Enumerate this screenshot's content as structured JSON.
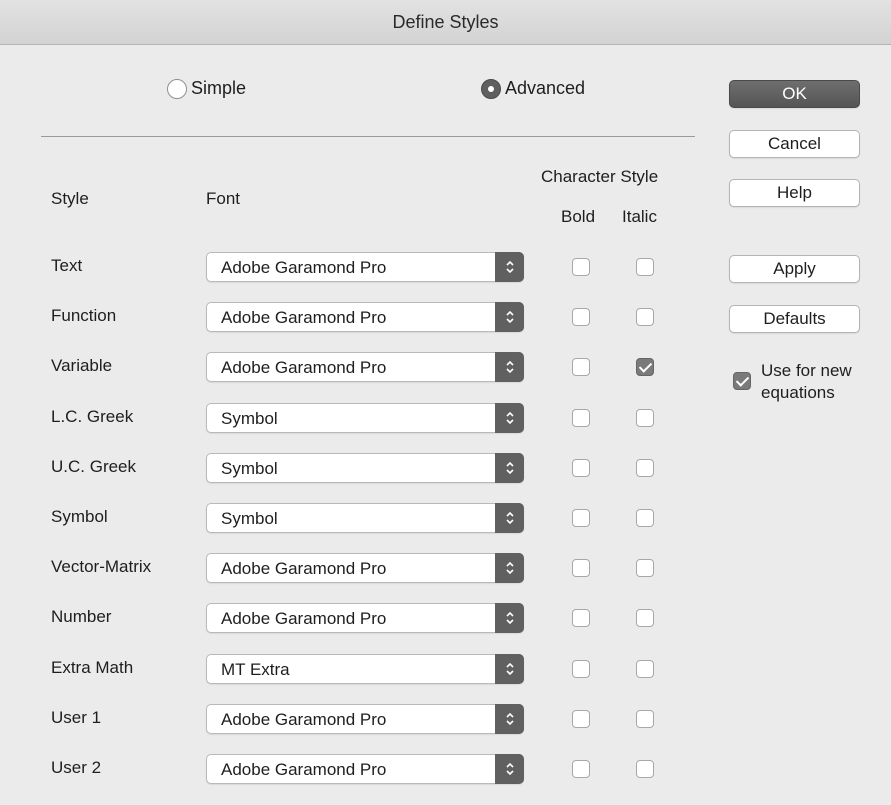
{
  "window": {
    "title": "Define Styles"
  },
  "mode": {
    "simple_label": "Simple",
    "advanced_label": "Advanced",
    "selected": "Advanced"
  },
  "headers": {
    "style": "Style",
    "font": "Font",
    "character_style": "Character Style",
    "bold": "Bold",
    "italic": "Italic"
  },
  "rows": [
    {
      "style": "Text",
      "font": "Adobe Garamond Pro",
      "bold": false,
      "italic": false
    },
    {
      "style": "Function",
      "font": "Adobe Garamond Pro",
      "bold": false,
      "italic": false
    },
    {
      "style": "Variable",
      "font": "Adobe Garamond Pro",
      "bold": false,
      "italic": true
    },
    {
      "style": "L.C. Greek",
      "font": "Symbol",
      "bold": false,
      "italic": false
    },
    {
      "style": "U.C. Greek",
      "font": "Symbol",
      "bold": false,
      "italic": false
    },
    {
      "style": "Symbol",
      "font": "Symbol",
      "bold": false,
      "italic": false
    },
    {
      "style": "Vector-Matrix",
      "font": "Adobe Garamond Pro",
      "bold": false,
      "italic": false
    },
    {
      "style": "Number",
      "font": "Adobe Garamond Pro",
      "bold": false,
      "italic": false
    },
    {
      "style": "Extra Math",
      "font": "MT Extra",
      "bold": false,
      "italic": false
    },
    {
      "style": "User 1",
      "font": "Adobe Garamond Pro",
      "bold": false,
      "italic": false
    },
    {
      "style": "User 2",
      "font": "Adobe Garamond Pro",
      "bold": false,
      "italic": false
    }
  ],
  "buttons": {
    "ok": "OK",
    "cancel": "Cancel",
    "help": "Help",
    "apply": "Apply",
    "defaults": "Defaults"
  },
  "use_for_new": {
    "label": "Use for new equations",
    "checked": true
  },
  "icons": {
    "select_arrow": "chevron-up-down-icon",
    "checkmark": "checkmark-icon"
  },
  "colors": {
    "window_bg": "#ebebeb",
    "accent": "#5f5f5f"
  }
}
